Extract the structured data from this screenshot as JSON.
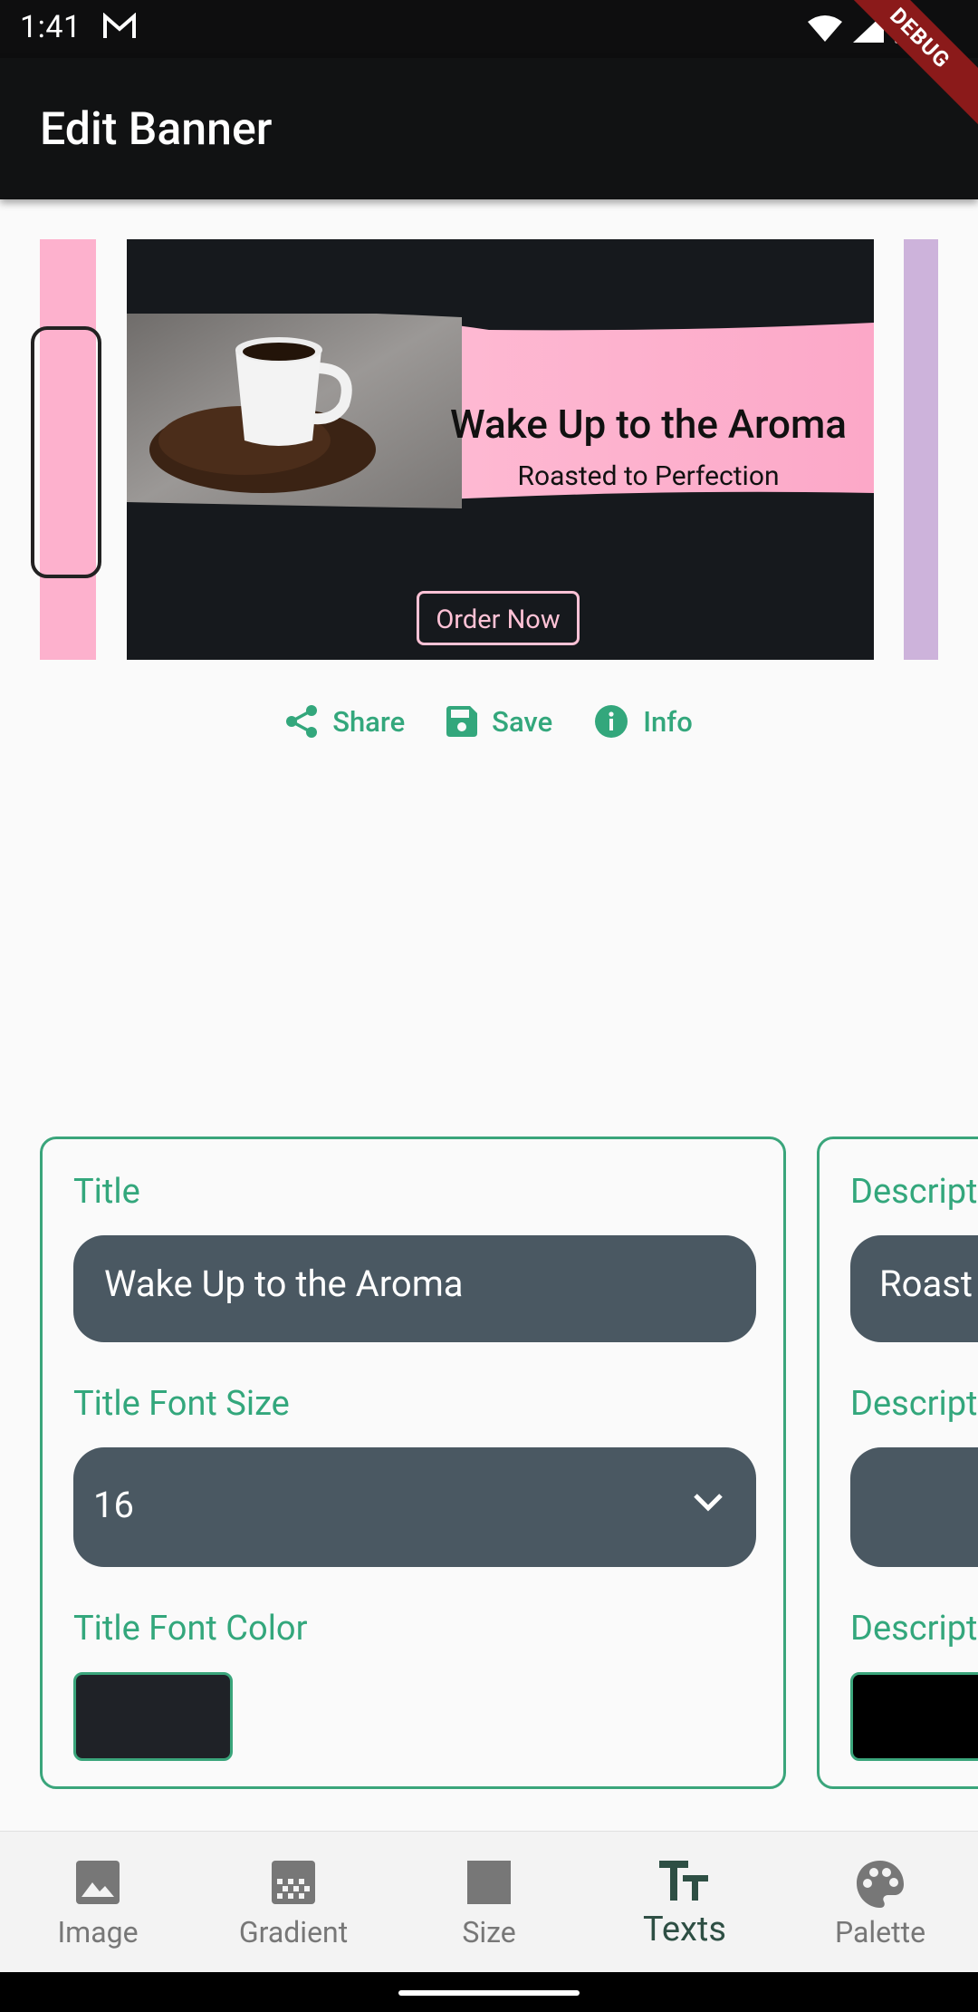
{
  "status": {
    "time": "1:41"
  },
  "appbar": {
    "title": "Edit Banner",
    "debug": "DEBUG"
  },
  "banner": {
    "title": "Wake Up to the Aroma",
    "subtitle": "Roasted to Perfection",
    "button": "Order Now",
    "colors": {
      "bg": "#16191d",
      "pink": "#fdb1cd",
      "btn": "#ffc2d6"
    }
  },
  "actions": {
    "share": "Share",
    "save": "Save",
    "info": "Info"
  },
  "card1": {
    "title_label": "Title",
    "title_value": "Wake Up to the Aroma",
    "font_size_label": "Title Font Size",
    "font_size_value": "16",
    "font_color_label": "Title Font Color"
  },
  "card2": {
    "label1": "Descript",
    "value1": "Roast",
    "label2": "Descript",
    "label3": "Descript"
  },
  "bottom_nav": [
    {
      "label": "Image",
      "icon": "image-icon"
    },
    {
      "label": "Gradient",
      "icon": "gradient-icon"
    },
    {
      "label": "Size",
      "icon": "size-icon"
    },
    {
      "label": "Texts",
      "icon": "text-fields-icon",
      "active": true
    },
    {
      "label": "Palette",
      "icon": "palette-icon"
    }
  ]
}
